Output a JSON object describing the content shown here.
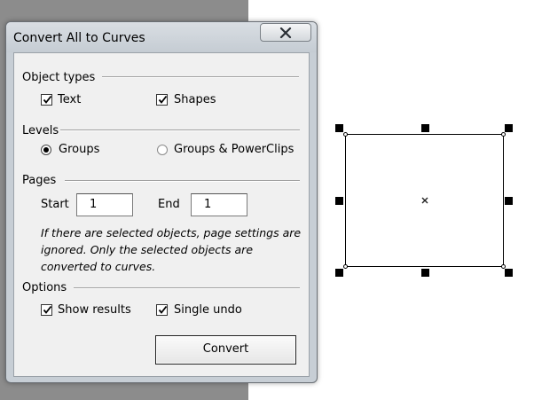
{
  "dialog": {
    "title": "Convert All to Curves",
    "close_glyph": "✕",
    "object_types": {
      "heading": "Object types",
      "text": {
        "label": "Text",
        "checked": true
      },
      "shapes": {
        "label": "Shapes",
        "checked": true
      }
    },
    "levels": {
      "heading": "Levels",
      "groups": {
        "label": "Groups",
        "selected": true
      },
      "groups_powerclips": {
        "label": "Groups & PowerClips",
        "selected": false
      }
    },
    "pages": {
      "heading": "Pages",
      "start_label": "Start",
      "start_value": "1",
      "end_label": "End",
      "end_value": "1",
      "note_lines": [
        "If there are selected objects, page settings are",
        "ignored. Only the selected objects are",
        "converted to curves."
      ]
    },
    "options": {
      "heading": "Options",
      "show_results": {
        "label": "Show results",
        "checked": true
      },
      "single_undo": {
        "label": "Single undo",
        "checked": true
      }
    },
    "convert_label": "Convert"
  },
  "colors": {
    "dialog_frame": "#c7ced5",
    "client_bg": "#f0f0f0",
    "background_gray": "#8c8c8c",
    "canvas": "#ffffff"
  },
  "icons": {
    "close": "close-icon",
    "check": "checkmark-icon",
    "center": "center-x-icon"
  }
}
